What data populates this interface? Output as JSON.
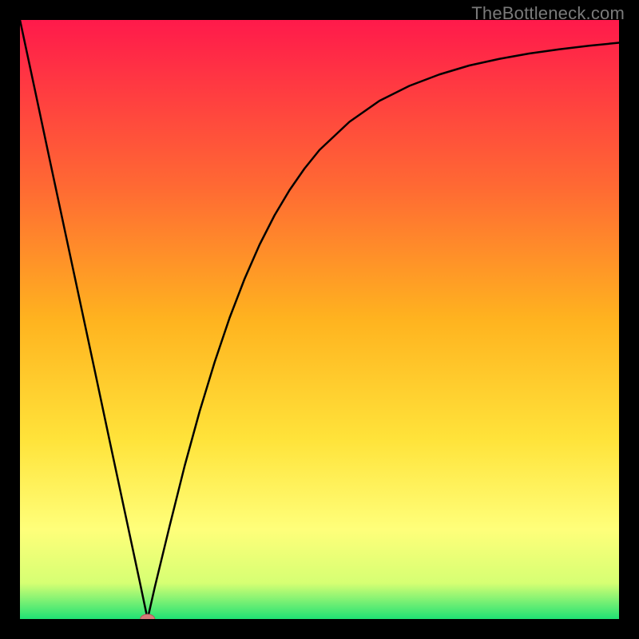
{
  "watermark": "TheBottleneck.com",
  "colors": {
    "frame": "#000000",
    "gradient_top": "#ff1a4b",
    "gradient_mid1": "#ff6a33",
    "gradient_mid2": "#ffb31f",
    "gradient_mid3": "#ffe33a",
    "gradient_mid4": "#ffff7a",
    "gradient_mid5": "#d6ff73",
    "gradient_bottom": "#1fe274",
    "curve": "#000000",
    "marker_fill": "#d77b7a",
    "marker_stroke": "#b45a59"
  },
  "chart_data": {
    "type": "line",
    "title": "",
    "xlabel": "",
    "ylabel": "",
    "xlim": [
      0,
      100
    ],
    "ylim": [
      0,
      100
    ],
    "grid": false,
    "legend": false,
    "series": [
      {
        "name": "curve",
        "x": [
          0,
          2.5,
          5,
          7.5,
          10,
          12.5,
          15,
          17.5,
          20,
          21.3,
          22.5,
          25,
          27.5,
          30,
          32.5,
          35,
          37.5,
          40,
          42.5,
          45,
          47.5,
          50,
          55,
          60,
          65,
          70,
          75,
          80,
          85,
          90,
          95,
          100
        ],
        "y": [
          100,
          88.3,
          76.5,
          64.8,
          53.1,
          41.4,
          29.6,
          17.9,
          6.2,
          0,
          5.3,
          15.6,
          25.6,
          34.7,
          42.9,
          50.3,
          56.8,
          62.5,
          67.4,
          71.6,
          75.2,
          78.3,
          83,
          86.5,
          89,
          90.9,
          92.4,
          93.5,
          94.4,
          95.1,
          95.7,
          96.2
        ]
      }
    ],
    "marker": {
      "x": 21.3,
      "y": 0,
      "rx": 9,
      "ry": 6
    }
  }
}
